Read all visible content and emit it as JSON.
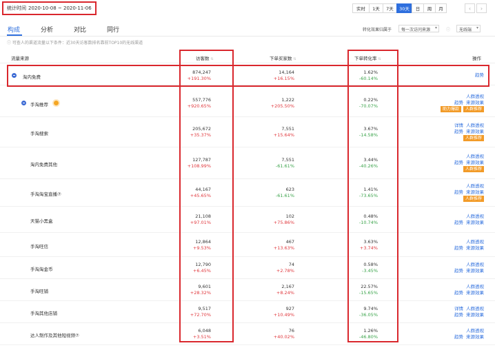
{
  "toolbar": {
    "date_label": "统计时间",
    "date_range": "2020-10-08 ~ 2020-11-06",
    "periods": [
      {
        "label": "实时",
        "active": false
      },
      {
        "label": "1天",
        "active": false
      },
      {
        "label": "7天",
        "active": false
      },
      {
        "label": "30天",
        "active": true
      },
      {
        "label": "日",
        "active": false
      },
      {
        "label": "周",
        "active": false
      },
      {
        "label": "月",
        "active": false
      }
    ],
    "prev": "‹",
    "next": "›"
  },
  "tabs": [
    {
      "label": "构成",
      "active": true
    },
    {
      "label": "分析",
      "active": false
    },
    {
      "label": "对比",
      "active": false
    },
    {
      "label": "同行",
      "active": false
    }
  ],
  "filters": {
    "attribution_label": "转化效果归属于",
    "attribution_value": "每一次访问来源",
    "device_value": "无线端"
  },
  "notice": "ⓘ 可查人的渠道流量以下条件：近30天访客数排名靠前TOP10的无线渠道",
  "columns": {
    "source": "流量来源",
    "visitors": "访客数",
    "buyers": "下单买家数",
    "conversion": "下单转化率",
    "ops": "操作"
  },
  "rows": [
    {
      "name": "淘内免费",
      "visitors": "874,247",
      "visitors_change": "+191.30%",
      "buyers": "14,164",
      "buyers_change": "+16.15%",
      "conv": "1.62%",
      "conv_change": "-60.14%",
      "ops": [
        [
          "趋势"
        ]
      ],
      "tags": []
    },
    {
      "name": "手淘推荐",
      "visitors": "557,776",
      "visitors_change": "+920.65%",
      "buyers": "1,222",
      "buyers_change": "+205.50%",
      "conv": "0.22%",
      "conv_change": "-70.07%",
      "ops": [
        [
          "人群透视"
        ],
        [
          "趋势",
          "来源效果"
        ]
      ],
      "tags": [
        "助力爆款",
        "人群推荐"
      ]
    },
    {
      "name": "手淘搜索",
      "visitors": "205,672",
      "visitors_change": "+35.37%",
      "buyers": "7,551",
      "buyers_change": "+15.64%",
      "conv": "3.67%",
      "conv_change": "-14.58%",
      "ops": [
        [
          "详情",
          "人群透视"
        ],
        [
          "趋势",
          "来源效果"
        ]
      ],
      "tags": [
        "人群推荐"
      ]
    },
    {
      "name": "淘内免费其他",
      "visitors": "127,787",
      "visitors_change": "+108.99%",
      "buyers": "7,551",
      "buyers_change": "-61.61%",
      "conv": "3.44%",
      "conv_change": "-40.26%",
      "ops": [
        [
          "人群透视"
        ],
        [
          "趋势",
          "来源效果"
        ]
      ],
      "tags": [
        "人群推荐"
      ]
    },
    {
      "name": "手淘淘宝直播⑦",
      "visitors": "44,167",
      "visitors_change": "+45.65%",
      "buyers": "623",
      "buyers_change": "-61.61%",
      "conv": "1.41%",
      "conv_change": "-73.65%",
      "ops": [
        [
          "人群透视"
        ],
        [
          "趋势",
          "来源效果"
        ]
      ],
      "tags": [
        "人群推荐"
      ]
    },
    {
      "name": "天猫小黑盒",
      "visitors": "21,108",
      "visitors_change": "+97.01%",
      "buyers": "102",
      "buyers_change": "+75.86%",
      "conv": "0.48%",
      "conv_change": "-10.74%",
      "ops": [
        [
          "人群透视"
        ],
        [
          "趋势",
          "来源效果"
        ]
      ],
      "tags": []
    },
    {
      "name": "手淘旺信",
      "visitors": "12,864",
      "visitors_change": "+9.53%",
      "buyers": "467",
      "buyers_change": "+13.63%",
      "conv": "3.63%",
      "conv_change": "+3.74%",
      "ops": [
        [
          "人群透视"
        ],
        [
          "趋势",
          "来源效果"
        ]
      ],
      "tags": []
    },
    {
      "name": "手淘淘金币",
      "visitors": "12,790",
      "visitors_change": "+6.45%",
      "buyers": "74",
      "buyers_change": "+2.78%",
      "conv": "0.58%",
      "conv_change": "-3.45%",
      "ops": [
        [
          "人群透视"
        ],
        [
          "趋势",
          "来源效果"
        ]
      ],
      "tags": []
    },
    {
      "name": "手淘旺铺",
      "visitors": "9,601",
      "visitors_change": "+28.32%",
      "buyers": "2,167",
      "buyers_change": "+8.24%",
      "conv": "22.57%",
      "conv_change": "-15.65%",
      "ops": [
        [
          "人群透视"
        ],
        [
          "趋势",
          "来源效果"
        ]
      ],
      "tags": []
    },
    {
      "name": "手淘其他店铺",
      "visitors": "9,517",
      "visitors_change": "+72.70%",
      "buyers": "927",
      "buyers_change": "+10.49%",
      "conv": "9.74%",
      "conv_change": "-36.05%",
      "ops": [
        [
          "详情",
          "人群透视"
        ],
        [
          "趋势",
          "来源效果"
        ]
      ],
      "tags": []
    },
    {
      "name": "达人制作及其他短视频⑦",
      "visitors": "6,048",
      "visitors_change": "+3.51%",
      "buyers": "76",
      "buyers_change": "+40.02%",
      "conv": "1.26%",
      "conv_change": "-46.80%",
      "ops": [
        [
          "人群透视"
        ],
        [
          "趋势",
          "来源效果"
        ]
      ],
      "tags": []
    }
  ]
}
